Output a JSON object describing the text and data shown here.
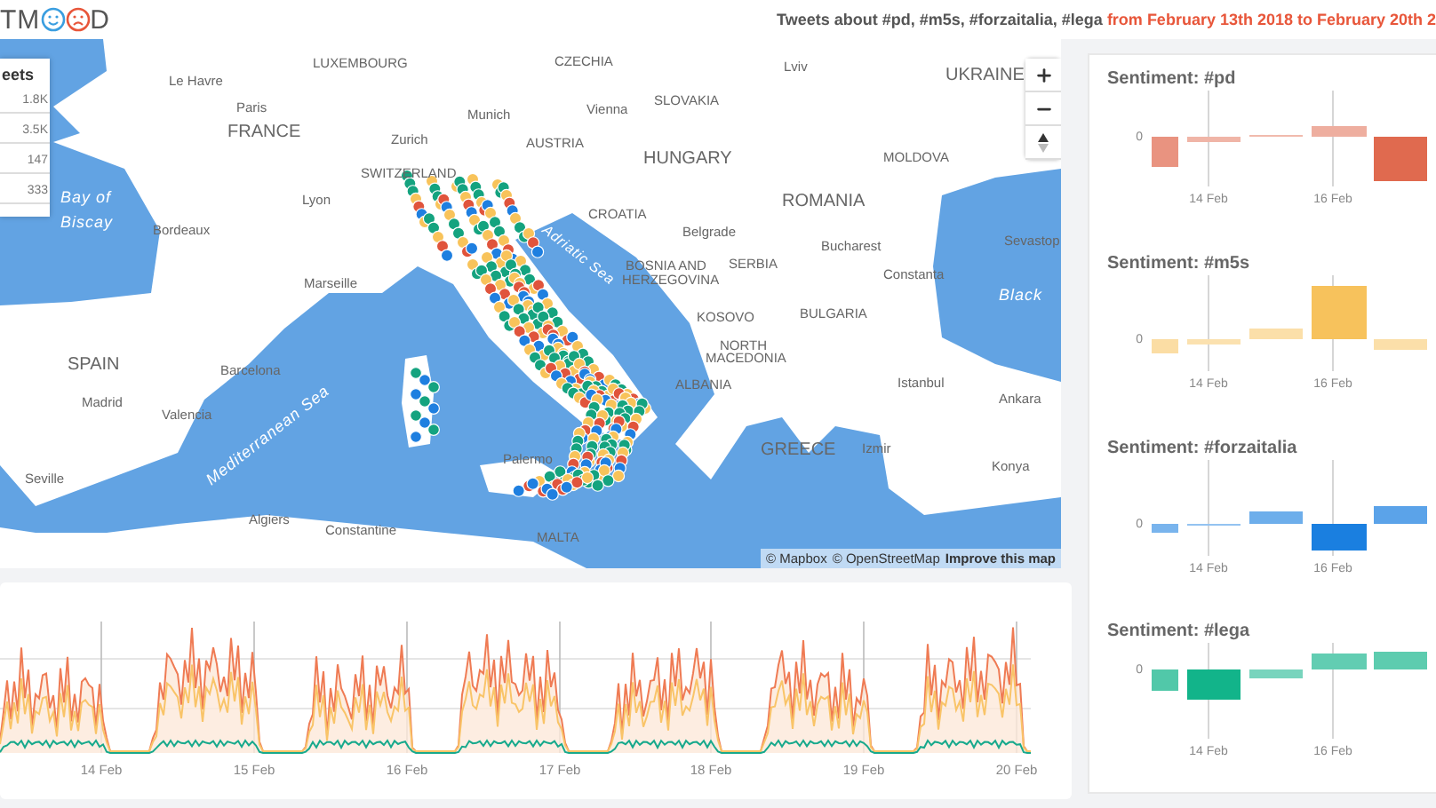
{
  "header": {
    "logo_before": "TM",
    "logo_after": "D",
    "title": "Tweets about #pd, #m5s, #forzaitalia, #lega",
    "range": "from February 13th 2018 to February 20th 2"
  },
  "map": {
    "places": [
      "LUXEMBOURG",
      "Le Havre",
      "Paris",
      "FRANCE",
      "Munich",
      "Zurich",
      "SWITZERLAND",
      "Lyon",
      "Bordeaux",
      "CZECHIA",
      "Lviv",
      "UKRAINE",
      "Vienna",
      "SLOVAKIA",
      "AUSTRIA",
      "HUNGARY",
      "MOLDOVA",
      "ROMANIA",
      "CROATIA",
      "Belgrade",
      "Bucharest",
      "Sevastop",
      "BOSNIA AND",
      "HERZEGOVINA",
      "SERBIA",
      "Constanta",
      "Marseille",
      "KOSOVO",
      "BULGARIA",
      "NORTH",
      "MACEDONIA",
      "SPAIN",
      "Barcelona",
      "Madrid",
      "Valencia",
      "ALBANIA",
      "Istanbul",
      "Ankara",
      "Palermo",
      "GREECE",
      "Izmir",
      "Konya",
      "Seville",
      "Algiers",
      "Constantine",
      "MALTA"
    ],
    "seas": [
      "Bay of",
      "Biscay",
      "Adriatic Sea",
      "Mediterranean Sea",
      "Black"
    ],
    "attribution": [
      "© Mapbox",
      "© OpenStreetMap",
      "Improve this map"
    ]
  },
  "legend": {
    "title": "eets",
    "values": [
      "1.8K",
      "3.5K",
      "147",
      "333"
    ]
  },
  "timeline": {
    "labels": [
      "14 Feb",
      "15 Feb",
      "16 Feb",
      "17 Feb",
      "18 Feb",
      "19 Feb",
      "20 Feb"
    ]
  },
  "sentiment": [
    {
      "title": "Sentiment: #pd",
      "color": "#e06a4f",
      "zero": "0",
      "labels": [
        "14 Feb",
        "16 Feb"
      ]
    },
    {
      "title": "Sentiment: #m5s",
      "color": "#f7c25c",
      "zero": "0",
      "labels": [
        "14 Feb",
        "16 Feb"
      ]
    },
    {
      "title": "Sentiment: #forzaitalia",
      "color": "#1a7fe0",
      "zero": "0",
      "labels": [
        "14 Feb",
        "16 Feb"
      ]
    },
    {
      "title": "Sentiment: #lega",
      "color": "#12b48a",
      "zero": "0",
      "labels": [
        "14 Feb",
        "16 Feb"
      ]
    }
  ]
}
